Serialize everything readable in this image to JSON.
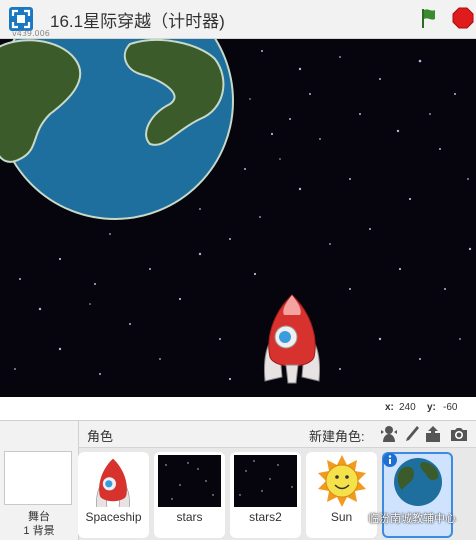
{
  "header": {
    "version": "v439.006",
    "title": "16.1星际穿越（计时器)"
  },
  "stage": {
    "x_label": "x:",
    "x_value": "240",
    "y_label": "y:",
    "y_value": "-60"
  },
  "stage_panel": {
    "label": "舞台",
    "backdrops": "1 背景"
  },
  "sprite_panel": {
    "title": "角色",
    "new_sprite_label": "新建角色:",
    "tools": [
      "choose-from-library-icon",
      "paint-brush-icon",
      "upload-icon",
      "camera-icon"
    ],
    "sprites": [
      {
        "name": "Spaceship"
      },
      {
        "name": "stars"
      },
      {
        "name": "stars2"
      },
      {
        "name": "Sun"
      },
      {
        "name": "",
        "selected": true
      }
    ]
  },
  "watermark": "临汾南城教辅中心",
  "colors": {
    "stage_bg": "#06040d",
    "flag": "#3a8a2e",
    "stop": "#e01b1b",
    "selection": "#3d8be0",
    "earth_ocean": "#1e6e9e",
    "earth_land": "#3b5c2a"
  }
}
